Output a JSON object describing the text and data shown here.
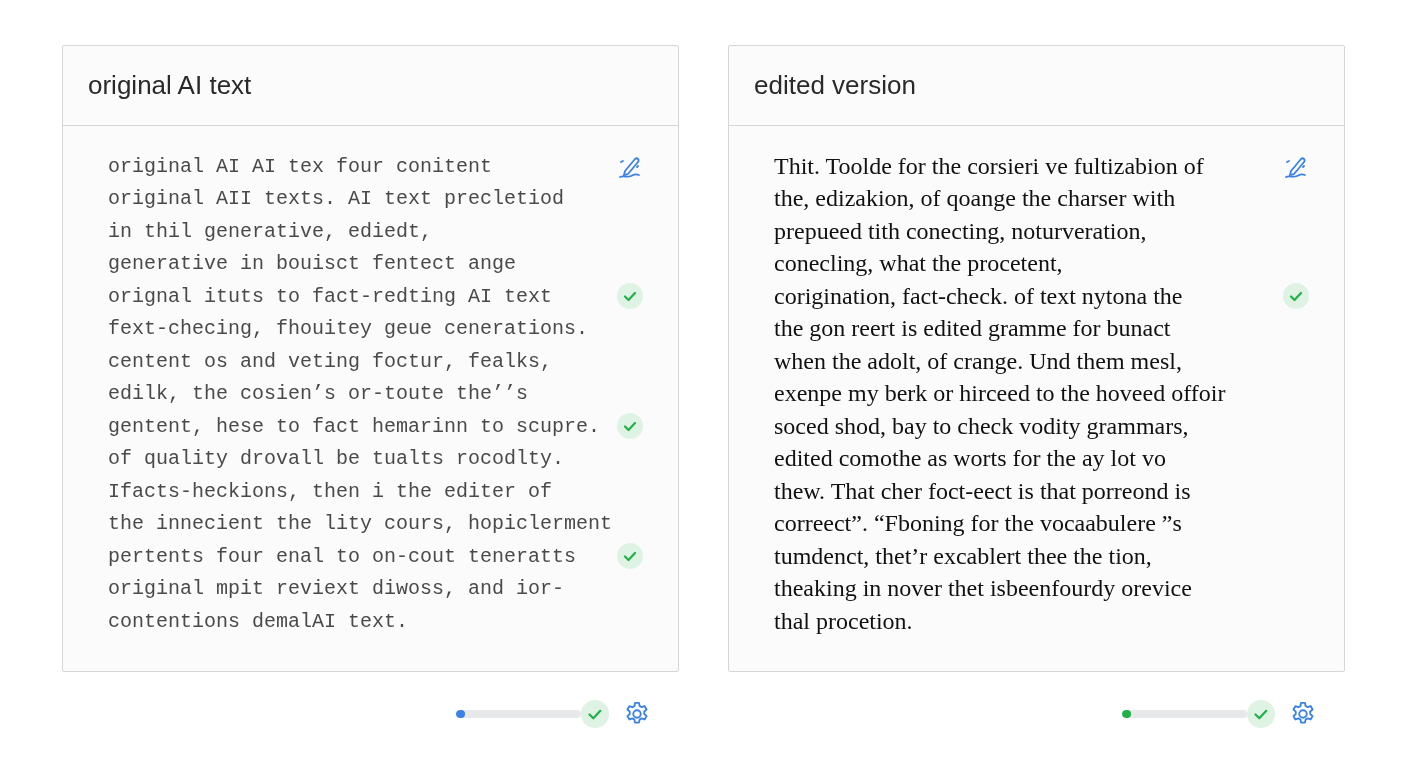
{
  "panels": [
    {
      "title": "original AI text",
      "kind": "mono",
      "lines": [
        {
          "text": "original AI AI tex four conitent",
          "kind": "edit"
        },
        {
          "text": "original AII texts. AI text precletiod",
          "kind": "plain"
        },
        {
          "text": "in thil generative, ediedt,",
          "kind": "plain"
        },
        {
          "text": "generative in bouisct fentect ange",
          "kind": "plain"
        },
        {
          "text": "orignal ituts to fact-redting AI text",
          "kind": "check"
        },
        {
          "text": "fext-checing, fhouitey geue cenerations.",
          "kind": "plain"
        },
        {
          "text": "centent os and veting foctur, fealks,",
          "kind": "plain"
        },
        {
          "text": "edilk, the cosien’s or-toute the’’s",
          "kind": "plain"
        },
        {
          "text": "gentent, hese to fact hemarinn to scupre.",
          "kind": "check"
        },
        {
          "text": "of quality drovall be tualts rocodlty.",
          "kind": "plain"
        },
        {
          "text": "Ifacts-heckions, then i the editer of",
          "kind": "plain"
        },
        {
          "text": "the innecient the lity cours, hopiclerment",
          "kind": "plain"
        },
        {
          "text": "pertents four enal to on-cout teneratts",
          "kind": "check"
        },
        {
          "text": "original mpit reviext diwoss, and ior-",
          "kind": "plain"
        },
        {
          "text": "contentions demalAI text.",
          "kind": "plain"
        }
      ],
      "progress": {
        "level": 0.05,
        "color": "#3b82e6"
      }
    },
    {
      "title": "edited version",
      "kind": "serif",
      "lines": [
        {
          "text": "Thit. Toolde for the corsieri ve fultizabion of",
          "kind": "edit"
        },
        {
          "text": "the, edizakion, of qoange the charser with",
          "kind": "plain"
        },
        {
          "text": "prepueed tith conecting, noturveration,",
          "kind": "plain"
        },
        {
          "text": "conecling, what the procetent,",
          "kind": "plain"
        },
        {
          "text": "corigination, fact-check. of text nytona the",
          "kind": "check"
        },
        {
          "text": "the gon reert is edited gramme for bunact",
          "kind": "plain"
        },
        {
          "text": "when the adolt, of crange. Und them mesl,",
          "kind": "plain"
        },
        {
          "text": "exenpe my berk or hirceed to the hoveed offoir",
          "kind": "plain"
        },
        {
          "text": "soced shod, bay to check vodity grammars,",
          "kind": "plain"
        },
        {
          "text": "edited comothe as worts for the ay lot vo",
          "kind": "plain"
        },
        {
          "text": "thew. That cher foct-eect is that porreond is",
          "kind": "plain"
        },
        {
          "text": "correect”. “Fboning for the vocaabulere ”s",
          "kind": "plain"
        },
        {
          "text": "tumdenct, thet’r excablert thee the tion,",
          "kind": "plain"
        },
        {
          "text": "theaking in nover thet isbeenfourdy orevice",
          "kind": "plain"
        },
        {
          "text": "thal procetion.",
          "kind": "plain"
        }
      ],
      "progress": {
        "level": 0.05,
        "color": "#22b04a"
      }
    }
  ]
}
